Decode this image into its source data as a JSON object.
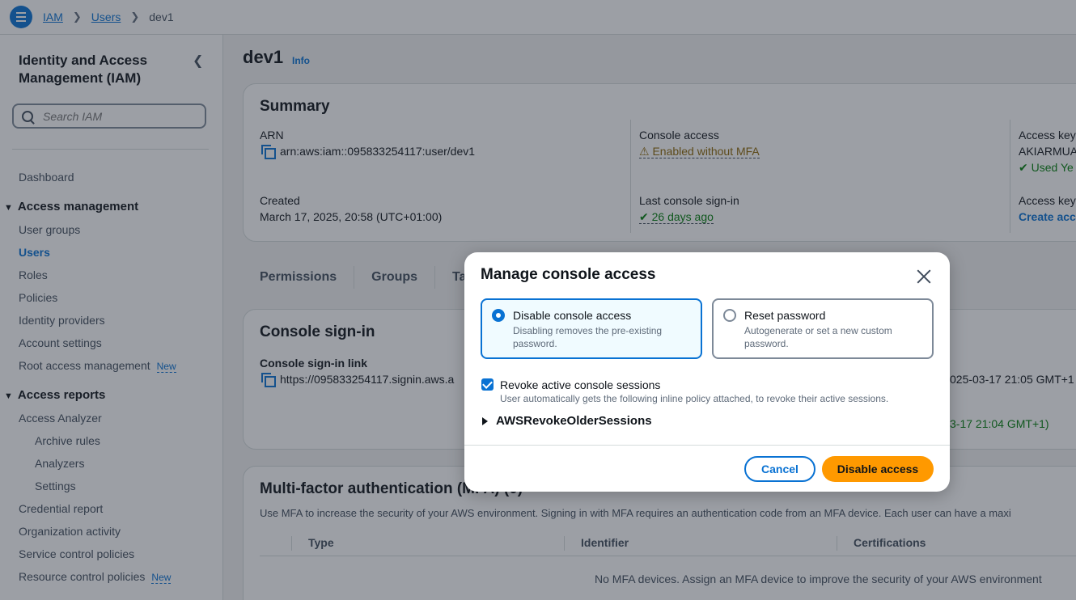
{
  "breadcrumb": {
    "items": [
      "IAM",
      "Users"
    ],
    "current": "dev1"
  },
  "sidebar": {
    "title": "Identity and Access Management (IAM)",
    "search_placeholder": "Search IAM",
    "dashboard": "Dashboard",
    "access_management": {
      "label": "Access management",
      "items": [
        "User groups",
        "Users",
        "Roles",
        "Policies",
        "Identity providers",
        "Account settings",
        "Root access management"
      ],
      "active": "Users"
    },
    "access_reports": {
      "label": "Access reports",
      "items": [
        "Access Analyzer",
        "Archive rules",
        "Analyzers",
        "Settings",
        "Credential report",
        "Organization activity",
        "Service control policies",
        "Resource control policies"
      ]
    },
    "new_badge": "New"
  },
  "page": {
    "title": "dev1",
    "info": "Info",
    "summary": {
      "title": "Summary",
      "arn_label": "ARN",
      "arn_value": "arn:aws:iam::095833254117:user/dev1",
      "created_label": "Created",
      "created_value": "March 17, 2025, 20:58 (UTC+01:00)",
      "console_access_label": "Console access",
      "console_access_value": "Enabled without MFA",
      "last_signin_label": "Last console sign-in",
      "last_signin_value": "26 days ago",
      "access_key_label": "Access key",
      "access_key_value": "AKIARMUA",
      "access_key_used": "Used Ye",
      "access_key2_label": "Access key",
      "access_key2_value": "Create acc"
    },
    "tabs": [
      "Permissions",
      "Groups",
      "Tag"
    ],
    "console_signin": {
      "title": "Console sign-in",
      "link_label": "Console sign-in link",
      "link_value": "https://095833254117.signin.aws.a",
      "right_value1": "025-03-17 21:05 GMT+1",
      "right_value2": "3-17 21:04 GMT+1)"
    },
    "mfa": {
      "title": "Multi-factor authentication (MFA) (0)",
      "description": "Use MFA to increase the security of your AWS environment. Signing in with MFA requires an authentication code from an MFA device. Each user can have a maxi",
      "columns": [
        "Type",
        "Identifier",
        "Certifications"
      ],
      "empty": "No MFA devices. Assign an MFA device to improve the security of your AWS environment"
    }
  },
  "modal": {
    "title": "Manage console access",
    "option_disable_label": "Disable console access",
    "option_disable_desc": "Disabling removes the pre-existing password.",
    "option_reset_label": "Reset password",
    "option_reset_desc": "Autogenerate or set a new custom password.",
    "revoke_label": "Revoke active console sessions",
    "revoke_desc": "User automatically gets the following inline policy attached, to revoke their active sessions.",
    "policy_name": "AWSRevokeOlderSessions",
    "cancel": "Cancel",
    "confirm": "Disable access"
  }
}
